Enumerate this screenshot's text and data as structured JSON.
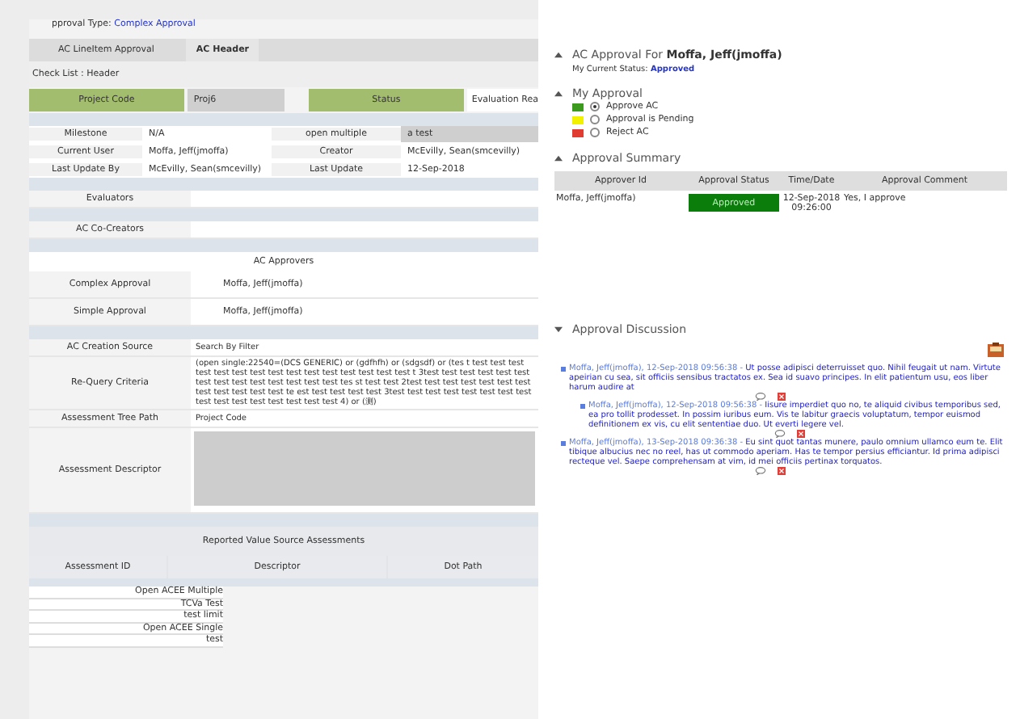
{
  "approval_type": {
    "label": "pproval Type:",
    "value": "Complex Approval"
  },
  "tabs": [
    {
      "label": "AC LineItem Approval",
      "selected": false
    },
    {
      "label": "AC Header",
      "selected": true
    }
  ],
  "breadcrumb": "Check List : Header",
  "header_row": {
    "project_code_label": "Project Code",
    "project_code_value": "Proj6",
    "status_label": "Status",
    "status_value": "Evaluation Rea"
  },
  "info_rows": [
    {
      "label": "Milestone",
      "value": "N/A",
      "label_2": "open multiple",
      "value_2": "a test"
    },
    {
      "label": "Current User",
      "value": "Moffa, Jeff(jmoffa)",
      "label_2": "Creator",
      "value_2": "McEvilly, Sean(smcevilly)"
    },
    {
      "label": "Last Update By",
      "value": "McEvilly, Sean(smcevilly)",
      "label_2": "Last Update",
      "value_2": "12-Sep-2018"
    }
  ],
  "evaluators": {
    "label": "Evaluators"
  },
  "co_creators": {
    "label": "AC Co-Creators"
  },
  "approvers": {
    "title": "AC Approvers",
    "rows": [
      {
        "label": "Complex Approval",
        "value": "Moffa, Jeff(jmoffa)"
      },
      {
        "label": "Simple Approval",
        "value": "Moffa, Jeff(jmoffa)"
      }
    ]
  },
  "criteria": [
    {
      "label": "AC Creation Source",
      "value": "Search By Filter"
    },
    {
      "label": "Re-Query Criteria",
      "value": "(open single:22540=(DCS GENERIC) or (gdfhfh) or (sdgsdf) or (tes t test test test test test test test test test test test test test test test t 3test test test test test test test test test test test test test test tes st test test 2test test test test test test test test test test test test te est test test test test 3test test test test test test test test test test test test test test test test 4) or (测)"
    },
    {
      "label": "Assessment Tree Path",
      "value": "Project Code"
    }
  ],
  "descriptor": {
    "label": "Assessment Descriptor"
  },
  "reported": {
    "title": "Reported Value Source Assessments",
    "columns": [
      "Assessment ID",
      "Descriptor",
      "Dot Path"
    ],
    "rows": [
      "Open ACEE Multiple",
      "TCVa Test",
      "test limit",
      "Open ACEE Single",
      "test"
    ]
  },
  "approval_for": {
    "label": "AC Approval For",
    "name": "Moffa, Jeff(jmoffa)",
    "status_label": "My Current Status:",
    "status_value": "Approved",
    "expanded": true
  },
  "my_approval": {
    "title": "My Approval",
    "expanded": true,
    "options": [
      {
        "label": "Approve AC",
        "color": "#3c9a1e",
        "selected": true
      },
      {
        "label": "Approval is Pending",
        "color": "#f2f200",
        "selected": false
      },
      {
        "label": "Reject AC",
        "color": "#e03c31",
        "selected": false
      }
    ]
  },
  "summary": {
    "title": "Approval Summary",
    "expanded": true,
    "columns": [
      "Approver Id",
      "Approval Status",
      "Time/Date",
      "Approval Comment"
    ],
    "rows": [
      {
        "approver": "Moffa, Jeff(jmoffa)",
        "status": "Approved",
        "color": "#0a7d0a",
        "time": "12-Sep-2018 09:26:00",
        "comment": "Yes, I approve"
      }
    ]
  },
  "discussion": {
    "title": "Approval Discussion",
    "expanded": false,
    "comments": [
      {
        "meta": "Moffa, Jeff(jmoffa), 12-Sep-2018 09:56:38 -",
        "text": "Ut posse adipisci deterruisset quo. Nihil feugait ut nam. Virtute apeirian cu sea, sit officiis sensibus tractatos ex. Sea id suavo principes. In elit patientum usu, eos liber harum audire at",
        "children": [
          {
            "meta": "Moffa, Jeff(jmoffa), 12-Sep-2018 09:56:38 -",
            "text": "Iisure imperdiet quo no, te aliquid civibus temporibus sed, ea pro tollit prodesset. In possim iuribus eum. Vis te labitur graecis voluptatum, tempor euismod definitionem ex vis, cu elit sententiae duo. Ut everti legere vel."
          }
        ]
      },
      {
        "meta": "Moffa, Jeff(jmoffa), 13-Sep-2018 09:36:38 -",
        "text": "Eu sint quot tantas munere, paulo omnium ullamco eum te. Elit tibique albucius nec no reel, has ut commodo aperiam. Has te tempor persius efficiantur. Id prima adipisci recteque vel. Saepe comprehensam at vim, id mei officiis pertinax torquatos."
      }
    ]
  }
}
